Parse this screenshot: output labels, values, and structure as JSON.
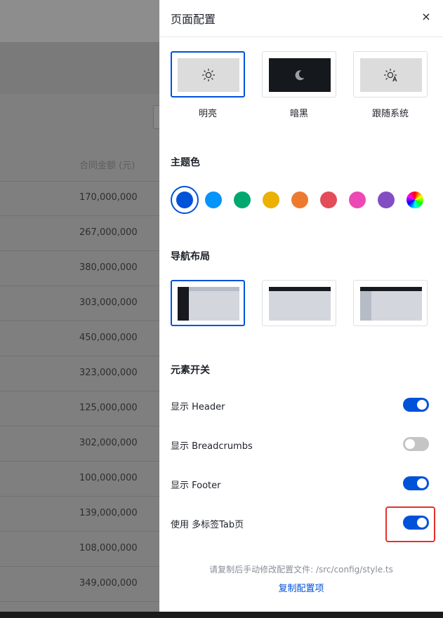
{
  "background": {
    "column_title": "合同金额 (元)",
    "amounts": [
      "170,000,000",
      "267,000,000",
      "380,000,000",
      "303,000,000",
      "450,000,000",
      "323,000,000",
      "125,000,000",
      "302,000,000",
      "100,000,000",
      "139,000,000",
      "108,000,000",
      "349,000,000"
    ]
  },
  "drawer": {
    "title": "页面配置",
    "close": "×",
    "modes": [
      {
        "label": "明亮",
        "icon": "sun-icon",
        "active": true
      },
      {
        "label": "暗黑",
        "icon": "moon-icon",
        "active": false
      },
      {
        "label": "跟随系统",
        "icon": "auto-theme-icon",
        "active": false
      }
    ],
    "theme_title": "主题色",
    "theme_colors": [
      "#0052d9",
      "#0594fa",
      "#00a870",
      "#ebb105",
      "#ed7b2f",
      "#e34d59",
      "#ed49b4",
      "#834ec2",
      "rainbow"
    ],
    "theme_selected": 0,
    "layout_title": "导航布局",
    "layouts": [
      {
        "name": "side-layout",
        "active": true
      },
      {
        "name": "top-layout",
        "active": false
      },
      {
        "name": "mix-layout",
        "active": false
      }
    ],
    "toggles_title": "元素开关",
    "toggles": [
      {
        "label": "显示 Header",
        "on": true
      },
      {
        "label": "显示 Breadcrumbs",
        "on": false
      },
      {
        "label": "显示 Footer",
        "on": true
      },
      {
        "label": "使用 多标签Tab页",
        "on": true
      }
    ],
    "note": "请复制后手动修改配置文件: /src/config/style.ts",
    "copy_label": "复制配置项"
  }
}
